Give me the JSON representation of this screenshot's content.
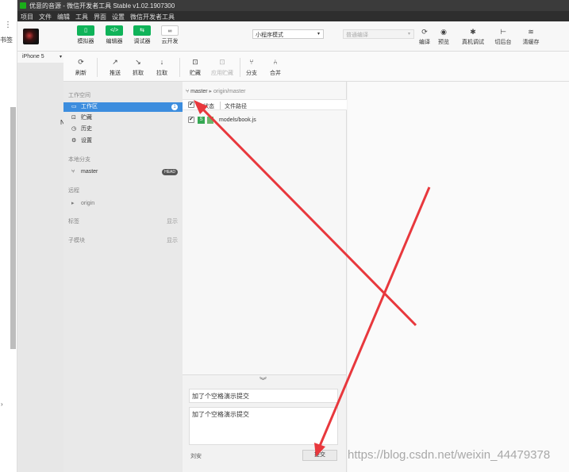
{
  "window": {
    "title": "优意的音源 - 微信开发者工具 Stable v1.02.1907300",
    "left_strip_label": "书签",
    "left_strip_menu": "⋮"
  },
  "menu": [
    "项目",
    "文件",
    "编辑",
    "工具",
    "界面",
    "设置",
    "微信开发者工具"
  ],
  "toolbar": {
    "green_buttons": [
      {
        "icon": "phone-icon",
        "glyph": "▯",
        "label": "模拟器"
      },
      {
        "icon": "code-icon",
        "glyph": "</>",
        "label": "编辑器"
      },
      {
        "icon": "debug-icon",
        "glyph": "⇆",
        "label": "调试器"
      }
    ],
    "cloud": {
      "icon": "cloud-icon",
      "glyph": "∞",
      "label": "云开发"
    },
    "mode_select": "小程序模式",
    "compile_select": "普通编译",
    "right_buttons": [
      {
        "icon": "refresh-icon",
        "glyph": "⟳",
        "label": "编译"
      },
      {
        "icon": "eye-icon",
        "glyph": "◉",
        "label": "预览"
      },
      {
        "icon": "bug-icon",
        "glyph": "✱",
        "label": "真机调试"
      },
      {
        "icon": "background-icon",
        "glyph": "⊢",
        "label": "切后台"
      },
      {
        "icon": "cache-icon",
        "glyph": "≋",
        "label": "清缓存"
      }
    ]
  },
  "simulator": {
    "device": "iPhone 5",
    "stray_text": "N"
  },
  "git": {
    "toolbar": [
      {
        "icon": "refresh-icon",
        "glyph": "⟳",
        "label": "刷新",
        "disabled": false
      },
      {
        "icon": "push-icon",
        "glyph": "↗",
        "label": "推送",
        "disabled": false
      },
      {
        "icon": "fetch-icon",
        "glyph": "↘",
        "label": "抓取",
        "disabled": false
      },
      {
        "icon": "pull-icon",
        "glyph": "↓",
        "label": "拉取",
        "disabled": false
      },
      {
        "icon": "stash-icon",
        "glyph": "⊡",
        "label": "贮藏",
        "disabled": false
      },
      {
        "icon": "apply-stash-icon",
        "glyph": "⊡",
        "label": "应用贮藏",
        "disabled": true
      },
      {
        "icon": "branch-icon",
        "glyph": "⑂",
        "label": "分支",
        "disabled": false
      },
      {
        "icon": "merge-icon",
        "glyph": "⑃",
        "label": "合并",
        "disabled": false
      }
    ],
    "sidebar": {
      "workspace_title": "工作空间",
      "items": [
        {
          "icon": "folder-icon",
          "glyph": "▭",
          "label": "工作区",
          "badge": "1"
        },
        {
          "icon": "stash-icon",
          "glyph": "⊡",
          "label": "贮藏"
        },
        {
          "icon": "history-icon",
          "glyph": "◷",
          "label": "历史"
        },
        {
          "icon": "settings-icon",
          "glyph": "⚙",
          "label": "设置"
        }
      ],
      "local_branch_title": "本地分支",
      "branch": {
        "icon": "branch-icon",
        "glyph": "⑂",
        "label": "master",
        "tag": "HEAD"
      },
      "remote_title": "远程",
      "remote": {
        "glyph": "▸",
        "label": "origin"
      },
      "tags_title": "标签",
      "tags_show": "显示",
      "submodules_title": "子模块",
      "submodules_show": "显示"
    },
    "content": {
      "branch_local": "master",
      "branch_sep": "▸",
      "branch_remote": "origin/master",
      "col_status": "状态",
      "col_path": "文件路径",
      "check_glyph": "✔",
      "files": [
        {
          "status": "S",
          "path": "models/book.js"
        }
      ]
    },
    "commit": {
      "collapse_glyph": "︾",
      "message": "加了个空格演示提交",
      "body": "加了个空格演示提交",
      "author": "刘安",
      "submit_label": "提交"
    }
  },
  "watermark": "https://blog.csdn.net/weixin_44479378",
  "colors": {
    "accent_green": "#0fb359",
    "accent_blue": "#3c8dde",
    "annotation_red": "#e8383d"
  }
}
